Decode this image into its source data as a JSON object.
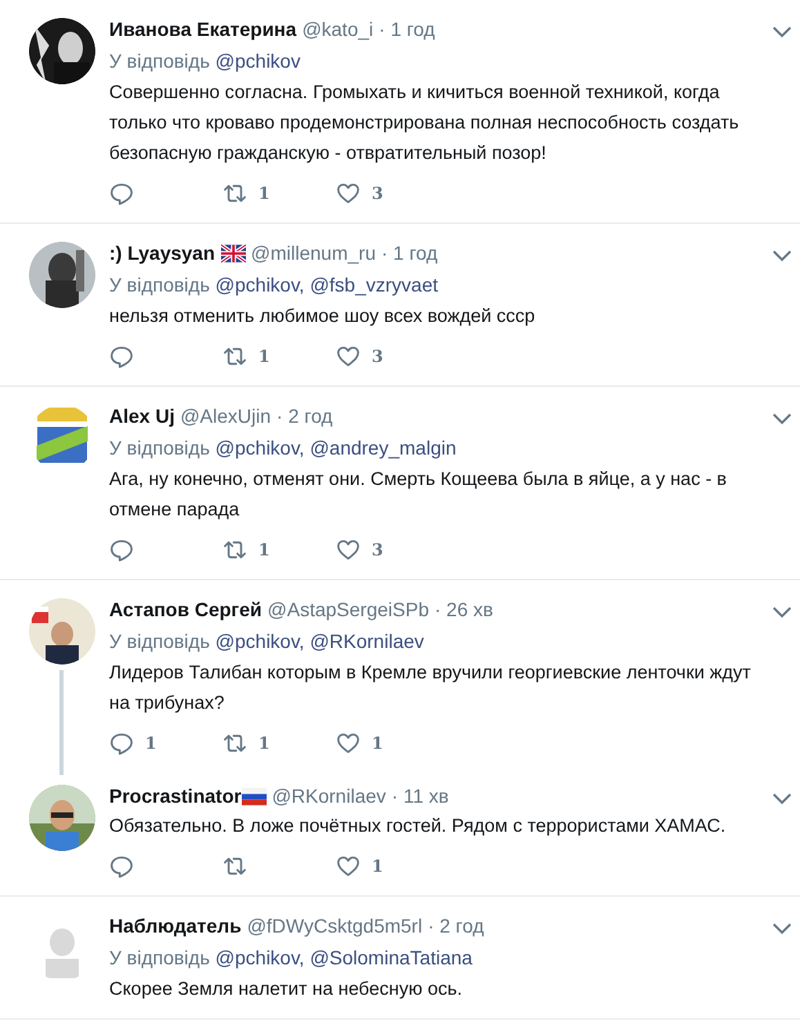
{
  "tweets": [
    {
      "name": "Иванова Екатерина",
      "handle": "@kato_i",
      "time": "· 1 год",
      "reply_to": {
        "label": "У відповідь",
        "mentions": [
          "@pchikov"
        ]
      },
      "text": "Совершенно согласна. Громыхать и кичиться военной техникой, когда только что кроваво продемонстрирована полная неспособность создать безопасную гражданскую - отвратительный позор!",
      "actions": {
        "retweets": "1",
        "likes": "3"
      },
      "connector": false
    },
    {
      "name": ":) Lyaysyan",
      "flag": {
        "kind": "uk"
      },
      "handle": "@millenum_ru",
      "time": "· 1 год",
      "reply_to": {
        "label": "У відповідь",
        "mentions": [
          "@pchikov,",
          "@fsb_vzryvaet"
        ]
      },
      "text": "нельзя отменить любимое шоу всех вождей ссср",
      "actions": {
        "retweets": "1",
        "likes": "3"
      },
      "connector": false
    },
    {
      "name": "Alex Uj",
      "handle": "@AlexUjin",
      "time": "· 2 год",
      "reply_to": {
        "label": "У відповідь",
        "mentions": [
          "@pchikov,",
          "@andrey_malgin"
        ]
      },
      "text": "Ага, ну конечно, отменят они. Смерть Кощеева была в яйце, а у нас - в отмене парада",
      "actions": {
        "retweets": "1",
        "likes": "3"
      },
      "connector": false
    },
    {
      "name": "Астапов Сергей",
      "handle": "@AstapSergeiSPb",
      "time": "· 26 хв",
      "reply_to": {
        "label": "У відповідь",
        "mentions": [
          "@pchikov,",
          "@RKornilaev"
        ]
      },
      "text": "Лидеров Талибан которым в Кремле вручили георгиевские ленточки ждут на трибунах?",
      "actions": {
        "replies": "1",
        "retweets": "1",
        "likes": "1"
      },
      "connector": true
    },
    {
      "name": "Procrastinator",
      "flag": {
        "kind": "ru"
      },
      "handle": "@RKornilaev",
      "time": "· 11 хв",
      "text": "Обязательно. В ложе почётных гостей. Рядом с террористами ХАМАС.",
      "actions": {
        "likes": "1"
      },
      "connector": false
    },
    {
      "name": "Наблюдатель",
      "handle": "@fDWyCsktgd5m5rl",
      "time": "· 2 год",
      "reply_to": {
        "label": "У відповідь",
        "mentions": [
          "@pchikov,",
          "@SolominaTatiana"
        ]
      },
      "text": "Скорее Земля налетит на небесную ось.",
      "connector": false
    }
  ]
}
